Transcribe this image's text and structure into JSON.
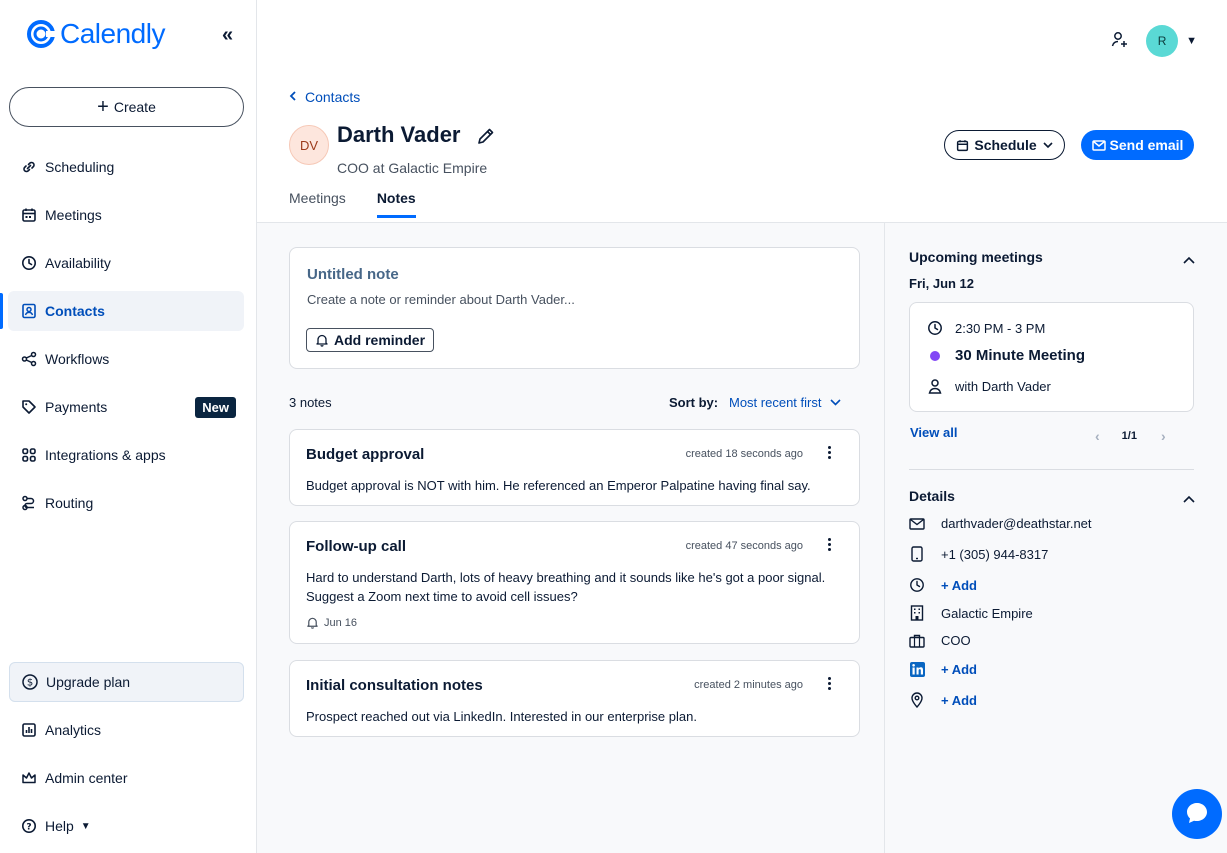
{
  "brand": {
    "name": "Calendly",
    "accent": "#006bff"
  },
  "sidebar": {
    "create_label": "Create",
    "items": [
      {
        "label": "Scheduling",
        "icon": "link-icon"
      },
      {
        "label": "Meetings",
        "icon": "calendar-icon"
      },
      {
        "label": "Availability",
        "icon": "clock-icon"
      },
      {
        "label": "Contacts",
        "icon": "contacts-icon",
        "active": true
      },
      {
        "label": "Workflows",
        "icon": "workflow-icon"
      },
      {
        "label": "Payments",
        "icon": "tag-icon",
        "badge": "New"
      },
      {
        "label": "Integrations & apps",
        "icon": "grid-icon"
      },
      {
        "label": "Routing",
        "icon": "routing-icon"
      }
    ],
    "upgrade_label": "Upgrade plan",
    "bottom_items": [
      {
        "label": "Analytics",
        "icon": "chart-icon"
      },
      {
        "label": "Admin center",
        "icon": "crown-icon"
      },
      {
        "label": "Help",
        "icon": "help-icon"
      }
    ]
  },
  "topbar": {
    "avatar_initial": "R"
  },
  "contact": {
    "back_label": "Contacts",
    "initials": "DV",
    "name": "Darth Vader",
    "title": "COO at Galactic Empire",
    "schedule_label": "Schedule",
    "send_email_label": "Send email",
    "tabs": [
      "Meetings",
      "Notes"
    ],
    "active_tab": "Notes"
  },
  "new_note": {
    "title": "Untitled note",
    "placeholder": "Create a note or reminder about Darth Vader...",
    "reminder_label": "Add reminder"
  },
  "notes_list": {
    "count_label": "3 notes",
    "sort_label": "Sort by:",
    "sort_value": "Most recent first",
    "notes": [
      {
        "title": "Budget approval",
        "created": "created 18 seconds ago",
        "body": "Budget approval is NOT with him. He referenced an Emperor Palpatine having final say."
      },
      {
        "title": "Follow-up call",
        "created": "created 47 seconds ago",
        "body": "Hard to understand Darth, lots of heavy breathing and it sounds like he's got a poor signal. Suggest a Zoom next time to avoid cell issues?",
        "reminder": "Jun 16"
      },
      {
        "title": "Initial consultation notes",
        "created": "created 2 minutes ago",
        "body": "Prospect reached out via LinkedIn. Interested in our enterprise plan."
      }
    ]
  },
  "upcoming": {
    "title": "Upcoming meetings",
    "date": "Fri, Jun 12",
    "time": "2:30 PM - 3 PM",
    "meeting_name": "30 Minute Meeting",
    "meeting_color": "#8247f5",
    "with": "with Darth Vader",
    "view_all": "View all",
    "pager": "1/1"
  },
  "details": {
    "title": "Details",
    "email": "darthvader@deathstar.net",
    "phone": "+1 (305) 944-8317",
    "timezone_add": "+ Add",
    "company": "Galactic Empire",
    "job_title": "COO",
    "linkedin_add": "+ Add",
    "location_add": "+ Add"
  }
}
